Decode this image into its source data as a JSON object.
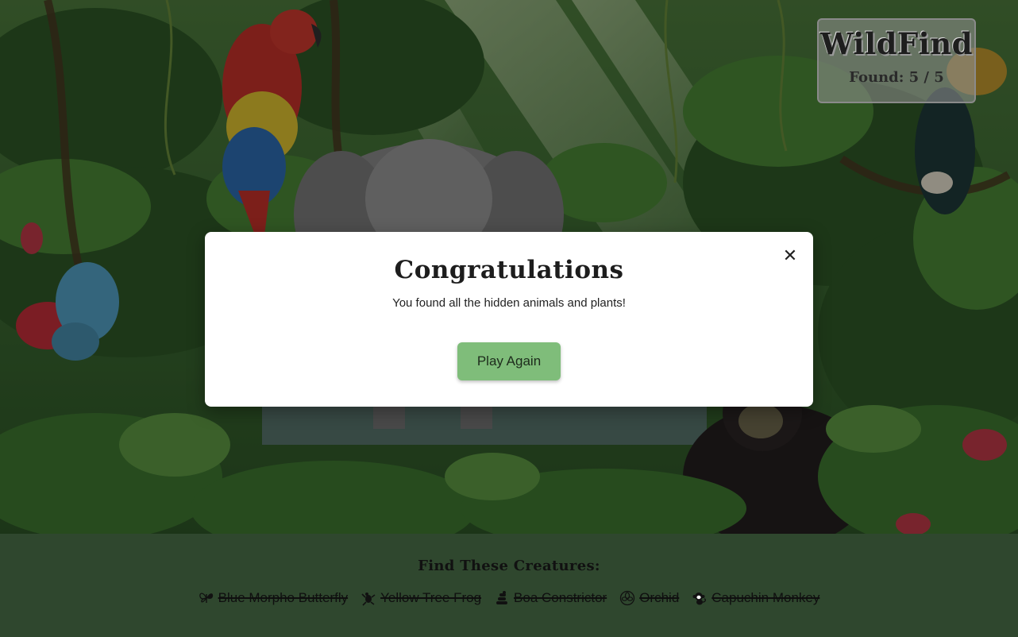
{
  "game": {
    "title": "WildFind",
    "found_label": "Found:",
    "found_count": 5,
    "total_count": 5,
    "score_text": "Found: 5 / 5"
  },
  "modal": {
    "title": "Congratulations",
    "message": "You found all the hidden animals and plants!",
    "button_label": "Play Again",
    "close_glyph": "✕"
  },
  "find_list": {
    "heading": "Find These Creatures:",
    "items": [
      {
        "label": "Blue Morpho Butterfly",
        "icon": "butterfly-icon",
        "found": true
      },
      {
        "label": "Yellow Tree Frog",
        "icon": "frog-icon",
        "found": true
      },
      {
        "label": "Boa Constrictor",
        "icon": "snake-icon",
        "found": true
      },
      {
        "label": "Orchid",
        "icon": "flower-icon",
        "found": true
      },
      {
        "label": "Capuchin Monkey",
        "icon": "monkey-icon",
        "found": true
      }
    ]
  },
  "colors": {
    "panel_bg": "#2f472e",
    "button_bg": "#7fbd7a",
    "modal_bg": "#ffffff"
  }
}
